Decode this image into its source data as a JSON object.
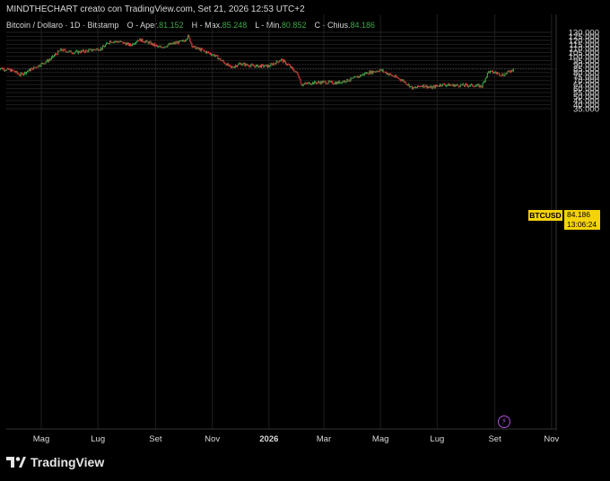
{
  "header": {
    "caption": "MINDTHECHART creato con TradingView.com, Set 21, 2026 12:53 UTC+2"
  },
  "legend": {
    "symbol_text": "Bitcoin / Dollaro · 1D · Bitstamp",
    "open_label": "O - Aper.",
    "open_value": "81.152",
    "high_label": "H - Max.",
    "high_value": "85.248",
    "low_label": "L - Min.",
    "low_value": "80.852",
    "close_label": "C - Chius.",
    "close_value": "84.186"
  },
  "price_marker": {
    "ticker": "BTCUSD",
    "price": "84.186",
    "countdown": "13:06:24"
  },
  "brand": {
    "name": "TradingView"
  },
  "colors": {
    "up": "#3fa64a",
    "down": "#e03b3b",
    "grid": "#1f1f1f",
    "background": "#000000",
    "marker": "#f5d30a",
    "event_icon": "#b04fd9"
  },
  "event_icon": "lightning-bolt-icon",
  "chart_data": {
    "type": "line",
    "title": "Bitcoin / Dollaro · 1D · Bitstamp",
    "xlabel": "",
    "ylabel": "",
    "ylim": [
      30000,
      131000
    ],
    "yticks": [
      "130.000",
      "125.000",
      "120.000",
      "115.000",
      "110.000",
      "105.000",
      "100.000",
      "95.000",
      "90.000",
      "85.000",
      "80.000",
      "75.000",
      "70.000",
      "65.000",
      "60.000",
      "55.000",
      "50.000",
      "45.000",
      "40.000",
      "35.000"
    ],
    "ytick_values": [
      130000,
      125000,
      120000,
      115000,
      110000,
      105000,
      100000,
      95000,
      90000,
      85000,
      80000,
      75000,
      70000,
      65000,
      60000,
      55000,
      50000,
      45000,
      40000,
      35000
    ],
    "xticks": [
      "Mag",
      "Lug",
      "Set",
      "Nov",
      "2026",
      "Mar",
      "Mag",
      "Lug",
      "Set",
      "Nov"
    ],
    "xtick_dates": [
      "2025-05-01",
      "2025-07-01",
      "2025-09-01",
      "2025-11-01",
      "2026-01-01",
      "2026-03-01",
      "2026-05-01",
      "2026-07-01",
      "2026-09-01",
      "2026-11-01"
    ],
    "grid": true,
    "series": [
      {
        "x": [
          "2025-03-15",
          "2025-04-01",
          "2025-04-08",
          "2025-04-22",
          "2025-05-10",
          "2025-05-22",
          "2025-06-05",
          "2025-06-20",
          "2025-07-05",
          "2025-07-14",
          "2025-07-25",
          "2025-08-05",
          "2025-08-14",
          "2025-08-25",
          "2025-09-05",
          "2025-09-20",
          "2025-10-01",
          "2025-10-06",
          "2025-10-11",
          "2025-10-20",
          "2025-11-04",
          "2025-11-21",
          "2025-12-01",
          "2025-12-15",
          "2026-01-01",
          "2026-01-14",
          "2026-01-22",
          "2026-02-01",
          "2026-02-05",
          "2026-02-15",
          "2026-03-01",
          "2026-03-15",
          "2026-04-01",
          "2026-04-15",
          "2026-05-01",
          "2026-05-10",
          "2026-05-25",
          "2026-06-05",
          "2026-06-15",
          "2026-06-25",
          "2026-07-05",
          "2026-07-20",
          "2026-08-05",
          "2026-08-18",
          "2026-08-25",
          "2026-09-01",
          "2026-09-10",
          "2026-09-21"
        ],
        "y": [
          86000,
          82000,
          77000,
          85000,
          96000,
          108000,
          105000,
          107000,
          110000,
          119000,
          118000,
          114000,
          121000,
          117000,
          111000,
          116000,
          119000,
          125000,
          112000,
          108000,
          101000,
          86000,
          91000,
          88000,
          88000,
          96000,
          89000,
          78000,
          65000,
          67000,
          68000,
          67000,
          72000,
          79000,
          83000,
          78000,
          70000,
          60000,
          64000,
          61000,
          65000,
          64000,
          64000,
          63000,
          81000,
          80000,
          77000,
          84186
        ]
      }
    ],
    "annotations": [
      "BTCUSD",
      "84.186",
      "13:06:24"
    ]
  }
}
